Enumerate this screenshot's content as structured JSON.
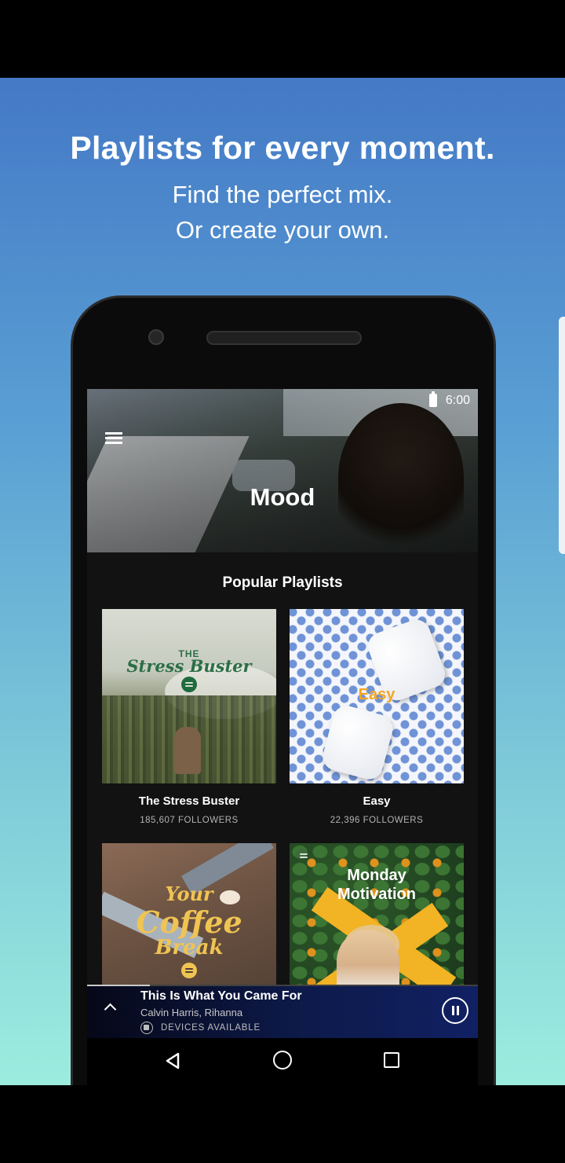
{
  "promo": {
    "headline": "Playlists for every moment.",
    "subline1": "Find the perfect mix.",
    "subline2": "Or create your own."
  },
  "status": {
    "time": "6:00"
  },
  "hero": {
    "title": "Mood"
  },
  "section": {
    "title": "Popular Playlists"
  },
  "playlists": [
    {
      "name": "The Stress Buster",
      "followers": "185,607 FOLLOWERS",
      "art_text_small": "THE",
      "art_text_big": "Stress Buster"
    },
    {
      "name": "Easy",
      "followers": "22,396 FOLLOWERS",
      "art_text": "Easy"
    },
    {
      "name": "Your Coffee Break",
      "art_text_1": "Your",
      "art_text_2": "Coffee",
      "art_text_3": "Break"
    },
    {
      "name": "Monday Motivation",
      "art_text_1": "Monday",
      "art_text_2": "Motivation"
    }
  ],
  "player": {
    "track": "This Is What You Came For",
    "artist": "Calvin Harris, Rihanna",
    "devices": "DEVICES AVAILABLE",
    "progress": 0.16
  },
  "colors": {
    "accent_green": "#1db954",
    "easy_text": "#f5a623",
    "coffee_text": "#f0c452"
  }
}
